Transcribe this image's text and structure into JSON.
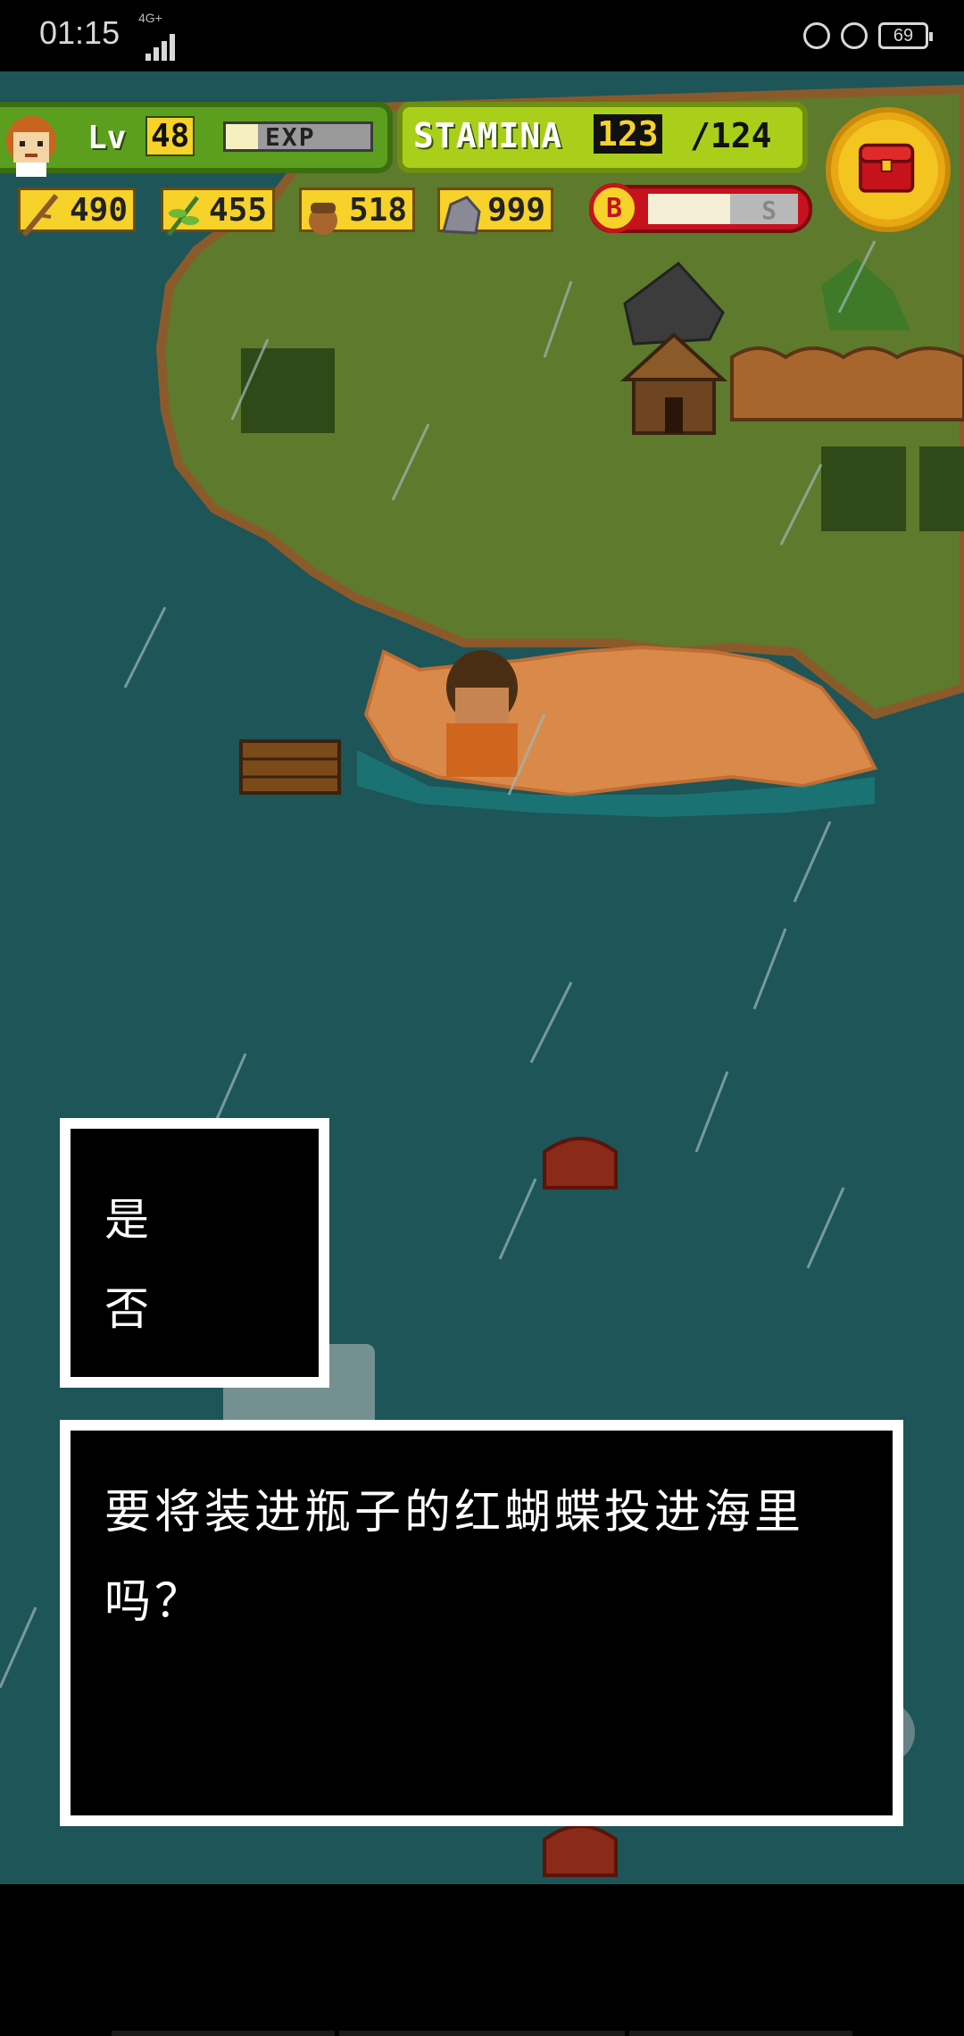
{
  "status_bar": {
    "time": "01:15",
    "network": "4G+",
    "battery": "69"
  },
  "hud": {
    "level_label": "Lv",
    "level": "48",
    "exp_label": "EXP",
    "exp_progress": 0.22,
    "stamina_label": "STAMINA",
    "stamina_current": "123",
    "stamina_max": "/124",
    "resources": [
      {
        "name": "branch",
        "icon": "branch-icon",
        "value": "490"
      },
      {
        "name": "leaf",
        "icon": "leaf-icon",
        "value": "455"
      },
      {
        "name": "nut",
        "icon": "acorn-icon",
        "value": "518"
      },
      {
        "name": "stone",
        "icon": "stone-icon",
        "value": "999"
      }
    ],
    "boost_label": "B",
    "boost_end_label": "S",
    "boost_progress": 0.55,
    "chest_icon": "treasure-chest-icon"
  },
  "dialog": {
    "choices": [
      "是",
      "否"
    ],
    "message": "要将装进瓶子的红蝴蝶投进海里吗？"
  },
  "colors": {
    "sea": "#1d5558",
    "grass": "#5e7a2c",
    "sand": "#d98a4a",
    "hud_green": "#5c9e1e",
    "hud_lime": "#a9cf1b",
    "hud_yellow": "#f6d22a",
    "boost_red": "#c6121d"
  }
}
